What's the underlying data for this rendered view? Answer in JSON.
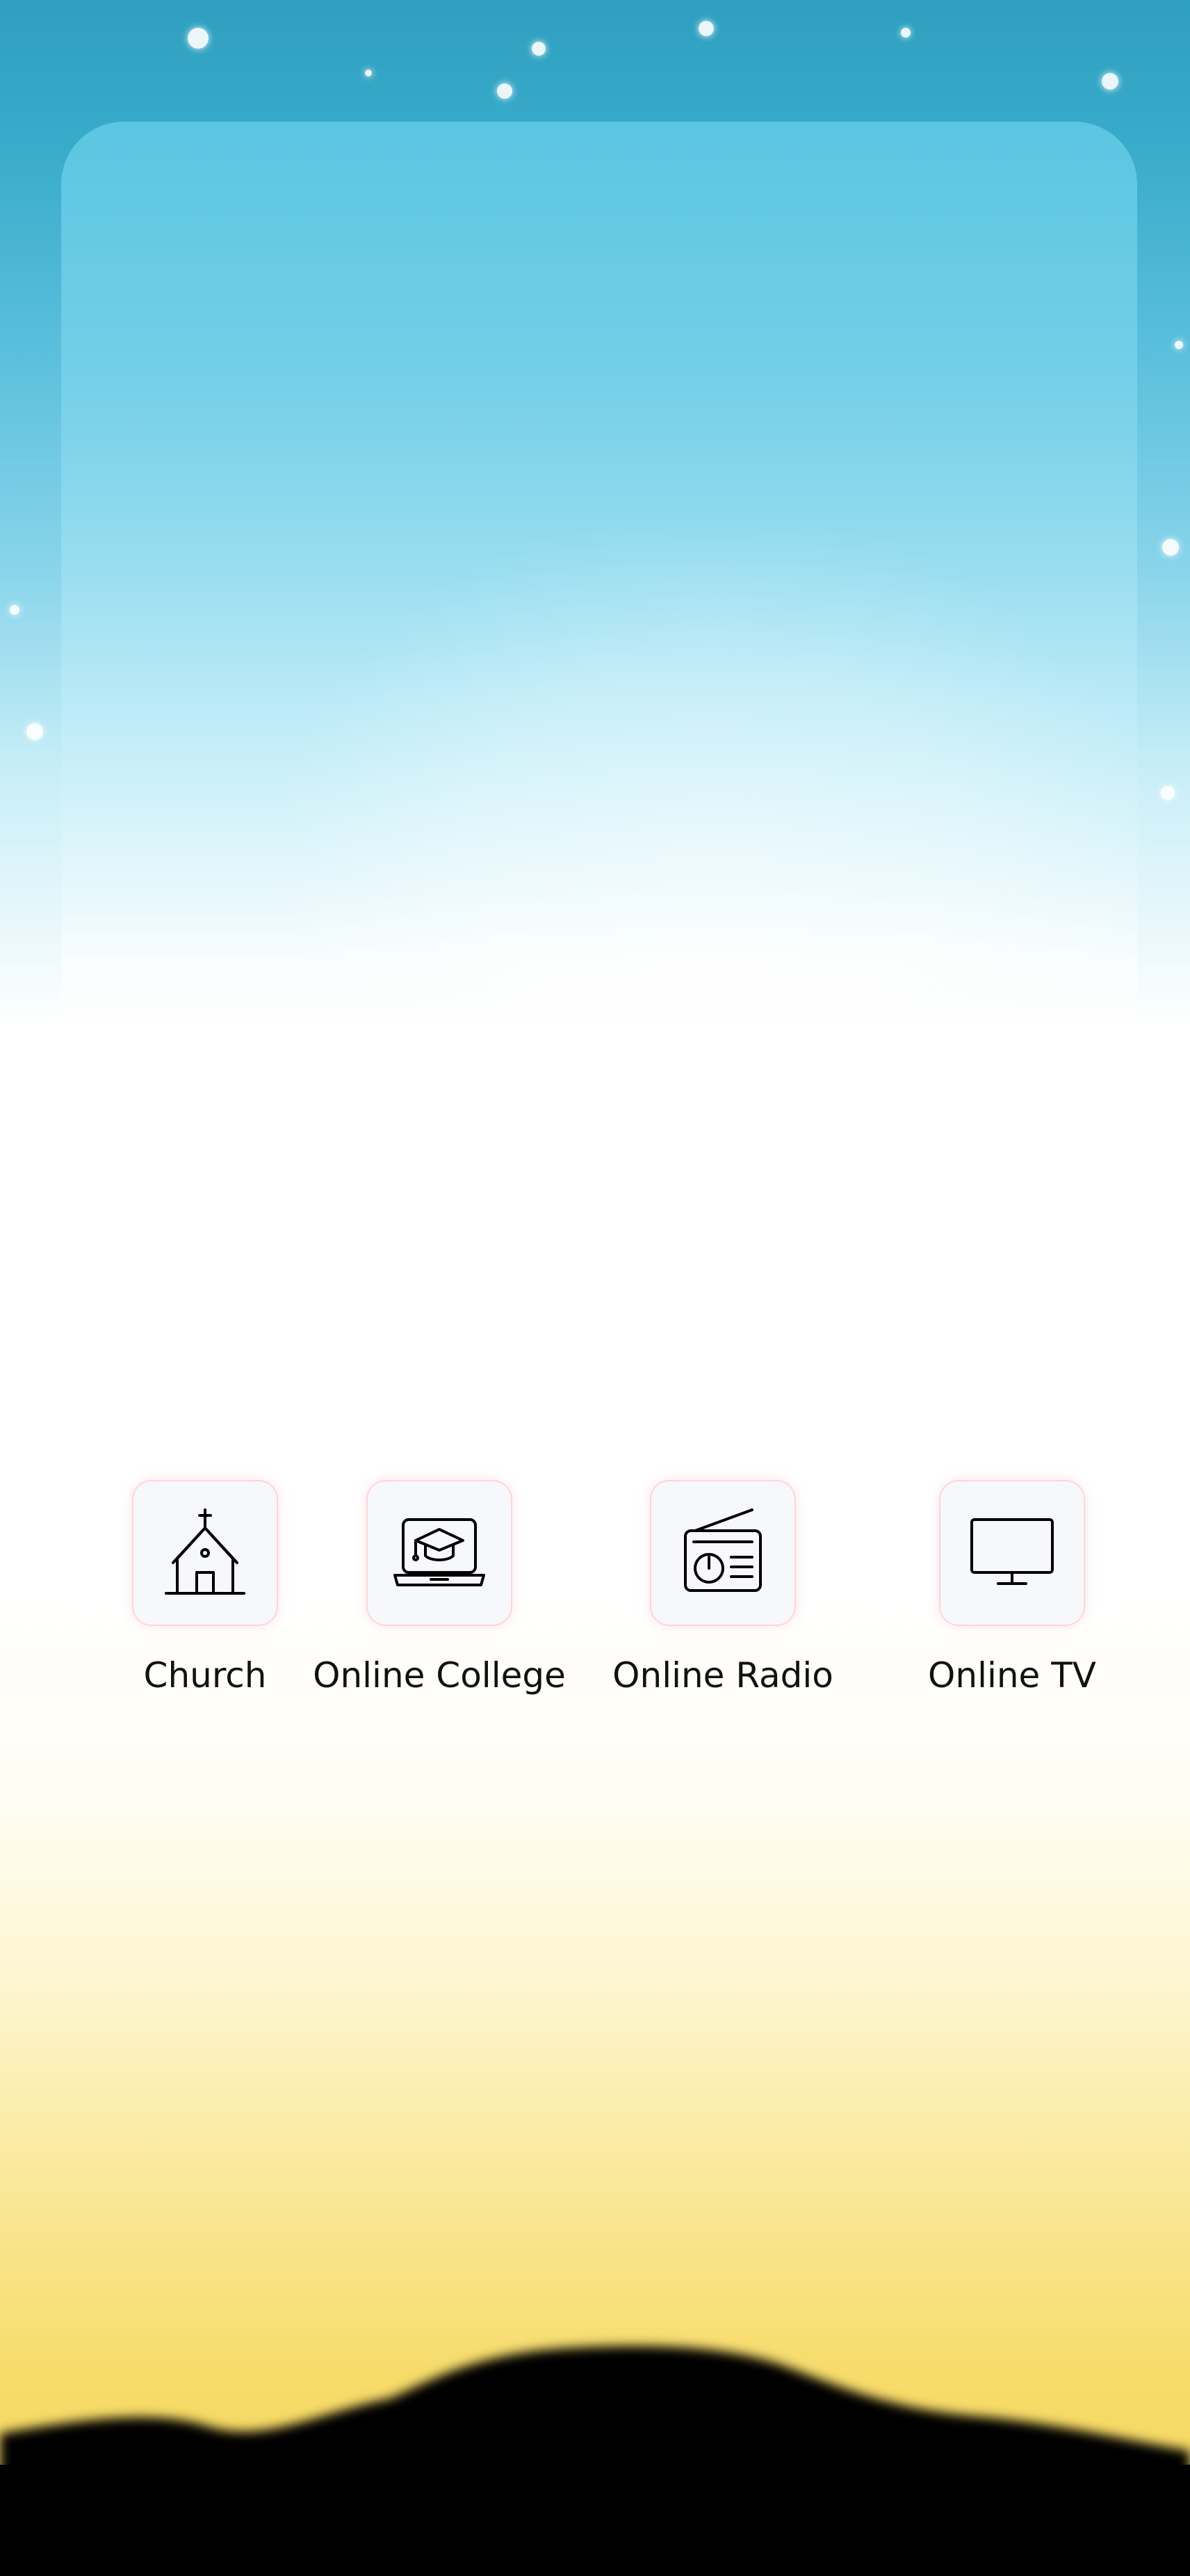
{
  "background": {
    "sky_top_color": "#2e9fbf",
    "glow_color": "#ffffff",
    "horizon_color": "#f4d55c",
    "ground_color": "#000000"
  },
  "nav": {
    "items": [
      {
        "label": "Church",
        "icon": "church-icon"
      },
      {
        "label": "Online College",
        "icon": "online-college-icon"
      },
      {
        "label": "Online Radio",
        "icon": "radio-icon"
      },
      {
        "label": "Online TV",
        "icon": "tv-icon"
      }
    ]
  },
  "colors": {
    "tile_background": "#f7f8fb",
    "tile_glow": "#ffa0aa",
    "label_text": "#111111",
    "icon_stroke": "#000000"
  }
}
